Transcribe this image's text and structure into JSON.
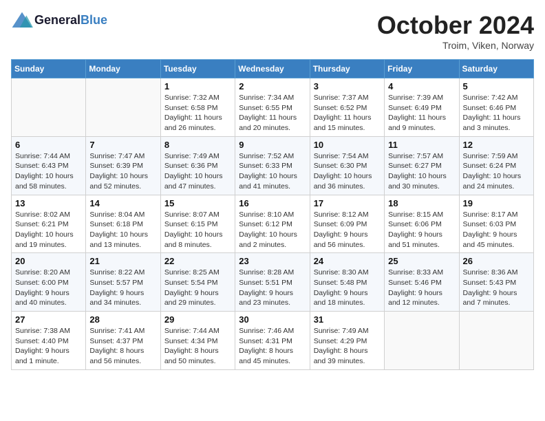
{
  "header": {
    "logo_line1": "General",
    "logo_line2": "Blue",
    "month_title": "October 2024",
    "location": "Troim, Viken, Norway"
  },
  "weekdays": [
    "Sunday",
    "Monday",
    "Tuesday",
    "Wednesday",
    "Thursday",
    "Friday",
    "Saturday"
  ],
  "weeks": [
    [
      {
        "day": "",
        "sunrise": "",
        "sunset": "",
        "daylight": ""
      },
      {
        "day": "",
        "sunrise": "",
        "sunset": "",
        "daylight": ""
      },
      {
        "day": "1",
        "sunrise": "Sunrise: 7:32 AM",
        "sunset": "Sunset: 6:58 PM",
        "daylight": "Daylight: 11 hours and 26 minutes."
      },
      {
        "day": "2",
        "sunrise": "Sunrise: 7:34 AM",
        "sunset": "Sunset: 6:55 PM",
        "daylight": "Daylight: 11 hours and 20 minutes."
      },
      {
        "day": "3",
        "sunrise": "Sunrise: 7:37 AM",
        "sunset": "Sunset: 6:52 PM",
        "daylight": "Daylight: 11 hours and 15 minutes."
      },
      {
        "day": "4",
        "sunrise": "Sunrise: 7:39 AM",
        "sunset": "Sunset: 6:49 PM",
        "daylight": "Daylight: 11 hours and 9 minutes."
      },
      {
        "day": "5",
        "sunrise": "Sunrise: 7:42 AM",
        "sunset": "Sunset: 6:46 PM",
        "daylight": "Daylight: 11 hours and 3 minutes."
      }
    ],
    [
      {
        "day": "6",
        "sunrise": "Sunrise: 7:44 AM",
        "sunset": "Sunset: 6:43 PM",
        "daylight": "Daylight: 10 hours and 58 minutes."
      },
      {
        "day": "7",
        "sunrise": "Sunrise: 7:47 AM",
        "sunset": "Sunset: 6:39 PM",
        "daylight": "Daylight: 10 hours and 52 minutes."
      },
      {
        "day": "8",
        "sunrise": "Sunrise: 7:49 AM",
        "sunset": "Sunset: 6:36 PM",
        "daylight": "Daylight: 10 hours and 47 minutes."
      },
      {
        "day": "9",
        "sunrise": "Sunrise: 7:52 AM",
        "sunset": "Sunset: 6:33 PM",
        "daylight": "Daylight: 10 hours and 41 minutes."
      },
      {
        "day": "10",
        "sunrise": "Sunrise: 7:54 AM",
        "sunset": "Sunset: 6:30 PM",
        "daylight": "Daylight: 10 hours and 36 minutes."
      },
      {
        "day": "11",
        "sunrise": "Sunrise: 7:57 AM",
        "sunset": "Sunset: 6:27 PM",
        "daylight": "Daylight: 10 hours and 30 minutes."
      },
      {
        "day": "12",
        "sunrise": "Sunrise: 7:59 AM",
        "sunset": "Sunset: 6:24 PM",
        "daylight": "Daylight: 10 hours and 24 minutes."
      }
    ],
    [
      {
        "day": "13",
        "sunrise": "Sunrise: 8:02 AM",
        "sunset": "Sunset: 6:21 PM",
        "daylight": "Daylight: 10 hours and 19 minutes."
      },
      {
        "day": "14",
        "sunrise": "Sunrise: 8:04 AM",
        "sunset": "Sunset: 6:18 PM",
        "daylight": "Daylight: 10 hours and 13 minutes."
      },
      {
        "day": "15",
        "sunrise": "Sunrise: 8:07 AM",
        "sunset": "Sunset: 6:15 PM",
        "daylight": "Daylight: 10 hours and 8 minutes."
      },
      {
        "day": "16",
        "sunrise": "Sunrise: 8:10 AM",
        "sunset": "Sunset: 6:12 PM",
        "daylight": "Daylight: 10 hours and 2 minutes."
      },
      {
        "day": "17",
        "sunrise": "Sunrise: 8:12 AM",
        "sunset": "Sunset: 6:09 PM",
        "daylight": "Daylight: 9 hours and 56 minutes."
      },
      {
        "day": "18",
        "sunrise": "Sunrise: 8:15 AM",
        "sunset": "Sunset: 6:06 PM",
        "daylight": "Daylight: 9 hours and 51 minutes."
      },
      {
        "day": "19",
        "sunrise": "Sunrise: 8:17 AM",
        "sunset": "Sunset: 6:03 PM",
        "daylight": "Daylight: 9 hours and 45 minutes."
      }
    ],
    [
      {
        "day": "20",
        "sunrise": "Sunrise: 8:20 AM",
        "sunset": "Sunset: 6:00 PM",
        "daylight": "Daylight: 9 hours and 40 minutes."
      },
      {
        "day": "21",
        "sunrise": "Sunrise: 8:22 AM",
        "sunset": "Sunset: 5:57 PM",
        "daylight": "Daylight: 9 hours and 34 minutes."
      },
      {
        "day": "22",
        "sunrise": "Sunrise: 8:25 AM",
        "sunset": "Sunset: 5:54 PM",
        "daylight": "Daylight: 9 hours and 29 minutes."
      },
      {
        "day": "23",
        "sunrise": "Sunrise: 8:28 AM",
        "sunset": "Sunset: 5:51 PM",
        "daylight": "Daylight: 9 hours and 23 minutes."
      },
      {
        "day": "24",
        "sunrise": "Sunrise: 8:30 AM",
        "sunset": "Sunset: 5:48 PM",
        "daylight": "Daylight: 9 hours and 18 minutes."
      },
      {
        "day": "25",
        "sunrise": "Sunrise: 8:33 AM",
        "sunset": "Sunset: 5:46 PM",
        "daylight": "Daylight: 9 hours and 12 minutes."
      },
      {
        "day": "26",
        "sunrise": "Sunrise: 8:36 AM",
        "sunset": "Sunset: 5:43 PM",
        "daylight": "Daylight: 9 hours and 7 minutes."
      }
    ],
    [
      {
        "day": "27",
        "sunrise": "Sunrise: 7:38 AM",
        "sunset": "Sunset: 4:40 PM",
        "daylight": "Daylight: 9 hours and 1 minute."
      },
      {
        "day": "28",
        "sunrise": "Sunrise: 7:41 AM",
        "sunset": "Sunset: 4:37 PM",
        "daylight": "Daylight: 8 hours and 56 minutes."
      },
      {
        "day": "29",
        "sunrise": "Sunrise: 7:44 AM",
        "sunset": "Sunset: 4:34 PM",
        "daylight": "Daylight: 8 hours and 50 minutes."
      },
      {
        "day": "30",
        "sunrise": "Sunrise: 7:46 AM",
        "sunset": "Sunset: 4:31 PM",
        "daylight": "Daylight: 8 hours and 45 minutes."
      },
      {
        "day": "31",
        "sunrise": "Sunrise: 7:49 AM",
        "sunset": "Sunset: 4:29 PM",
        "daylight": "Daylight: 8 hours and 39 minutes."
      },
      {
        "day": "",
        "sunrise": "",
        "sunset": "",
        "daylight": ""
      },
      {
        "day": "",
        "sunrise": "",
        "sunset": "",
        "daylight": ""
      }
    ]
  ]
}
